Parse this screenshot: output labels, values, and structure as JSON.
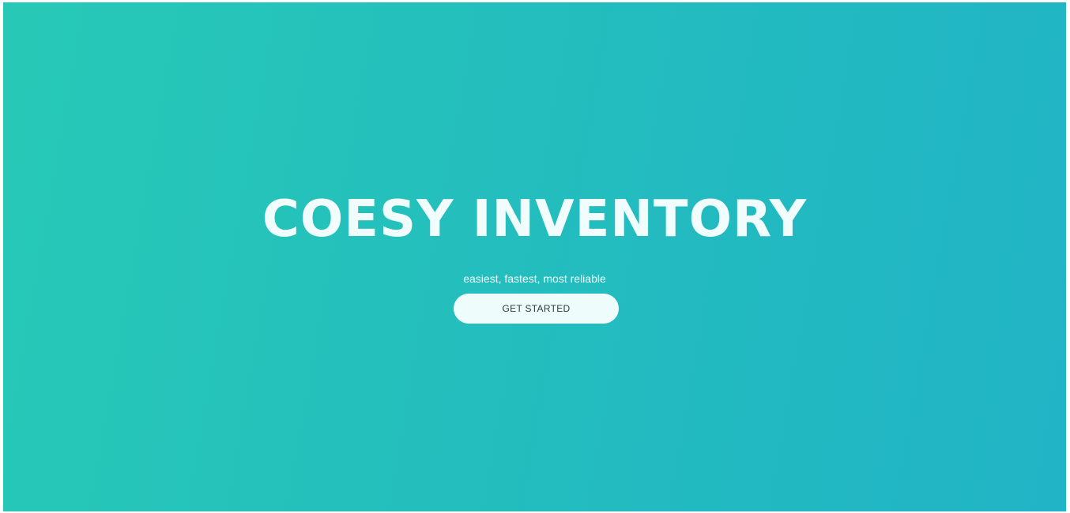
{
  "hero": {
    "title": "COESY INVENTORY",
    "subtitle": "easiest, fastest, most reliable",
    "cta_label": "GET STARTED"
  },
  "colors": {
    "gradient_start": "#27c9b6",
    "gradient_end": "#21b4c6",
    "title_text": "#f1fdfd",
    "button_bg": "#effcfc",
    "button_text": "#2b3b40"
  }
}
